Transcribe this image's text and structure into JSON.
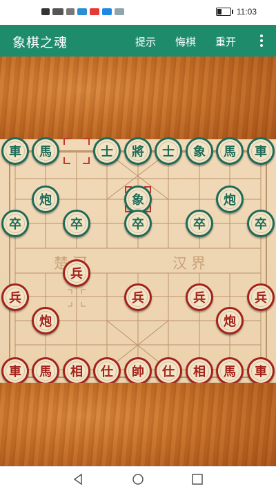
{
  "status": {
    "time": "11:03",
    "left_icons": [
      "hd-icon",
      "signal-icon",
      "wifi-icon",
      "app-icon-1",
      "app-icon-2",
      "app-icon-3",
      "app-icon-4"
    ]
  },
  "appbar": {
    "title": "象棋之魂",
    "hint": "提示",
    "undo": "悔棋",
    "restart": "重开",
    "bg": "#1e8c6b"
  },
  "river": {
    "left": "楚河",
    "right": "汉界"
  },
  "pieces": {
    "black_back": [
      "車",
      "馬",
      "士",
      "將",
      "士",
      "象",
      "馬",
      "車"
    ],
    "black_elephant_moved": "象",
    "black_cannons": [
      "炮",
      "炮"
    ],
    "black_soldiers": [
      "卒",
      "卒",
      "卒",
      "卒",
      "卒"
    ],
    "red_soldiers": [
      "兵",
      "兵",
      "兵",
      "兵",
      "兵"
    ],
    "red_cannons": [
      "炮",
      "炮"
    ],
    "red_back": [
      "車",
      "馬",
      "相",
      "仕",
      "帥",
      "仕",
      "相",
      "馬",
      "車"
    ]
  },
  "colors": {
    "black_piece": "#1f6b57",
    "red_piece": "#a3231b",
    "highlight": "#c0392b"
  }
}
